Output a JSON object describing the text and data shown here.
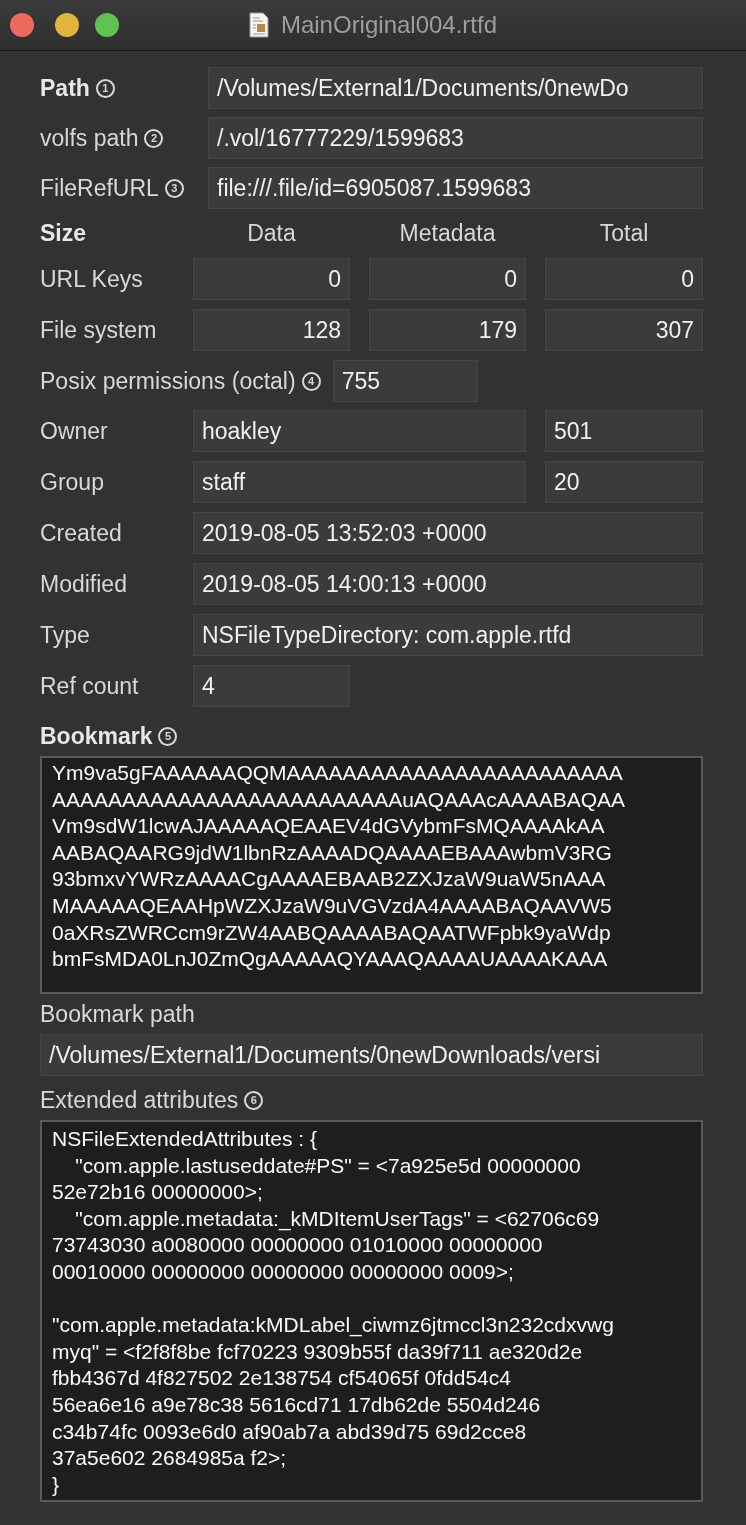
{
  "window": {
    "title": "MainOriginal004.rtfd"
  },
  "identifiers": [
    {
      "label": "Path",
      "bold": true,
      "badge": "1",
      "value": "/Volumes/External1/Documents/0newDo"
    },
    {
      "label": "volfs path",
      "bold": false,
      "badge": "2",
      "value": "/.vol/16777229/1599683"
    },
    {
      "label": "FileRefURL",
      "bold": false,
      "badge": "3",
      "value": "file:///.file/id=6905087.1599683"
    }
  ],
  "size": {
    "label": "Size",
    "columns": [
      "Data",
      "Metadata",
      "Total"
    ],
    "rows": [
      {
        "label": "URL Keys",
        "values": [
          "0",
          "0",
          "0"
        ]
      },
      {
        "label": "File system",
        "values": [
          "128",
          "179",
          "307"
        ]
      }
    ]
  },
  "posix": {
    "label": "Posix permissions (octal)",
    "badge": "4",
    "value": "755"
  },
  "attributes": [
    {
      "kind": "pair",
      "label": "Owner",
      "values": [
        "hoakley",
        "501"
      ]
    },
    {
      "kind": "pair",
      "label": "Group",
      "values": [
        "staff",
        "20"
      ]
    },
    {
      "kind": "wide",
      "label": "Created",
      "values": [
        "2019-08-05 13:52:03 +0000"
      ]
    },
    {
      "kind": "wide",
      "label": "Modified",
      "values": [
        "2019-08-05 14:00:13 +0000"
      ]
    },
    {
      "kind": "wide",
      "label": "Type",
      "values": [
        "NSFileTypeDirectory: com.apple.rtfd"
      ]
    },
    {
      "kind": "short",
      "label": "Ref count",
      "values": [
        "4"
      ]
    }
  ],
  "bookmark": {
    "label": "Bookmark",
    "badge": "5",
    "lines": [
      "Ym9va5gFAAAAAAQQMAAAAAAAAAAAAAAAAAAAAAAAA",
      "AAAAAAAAAAAAAAAAAAAAAAAAAuAQAAAcAAAABAQAA",
      "Vm9sdW1lcwAJAAAAAQEAAEV4dGVybmFsMQAAAAkAA",
      "AABAQAARG9jdW1lbnRzAAAADQAAAAEBAAAwbmV3RG",
      "93bmxvYWRzAAAACgAAAAEBAAB2ZXJzaW9uaW5nAAA",
      "MAAAAAQEAAHpWZXJzaW9uVGVzdA4AAAABAQAAVW5",
      "0aXRsZWRCcm9rZW4AABQAAAABAQAATWFpbk9yaWdp",
      "bmFsMDA0LnJ0ZmQgAAAAAQYAAAQAAAAUAAAAKAAA"
    ]
  },
  "bookmark_path": {
    "label": "Bookmark path",
    "value": "/Volumes/External1/Documents/0newDownloads/versi"
  },
  "extended_attributes": {
    "label": "Extended attributes",
    "badge": "6",
    "blocks": [
      [
        "NSFileExtendedAttributes : {",
        "    \"com.apple.lastuseddate#PS\" = <7a925e5d 00000000",
        "52e72b16 00000000>;",
        "    \"com.apple.metadata:_kMDItemUserTags\" = <62706c69",
        "73743030 a0080000 00000000 01010000 00000000",
        "00010000 00000000 00000000 00000000 0009>;"
      ],
      [
        "\"com.apple.metadata:kMDLabel_ciwmz6jtmccl3n232cdxvwg",
        "myq\" = <f2f8f8be fcf70223 9309b55f da39f711 ae320d2e",
        "fbb4367d 4f827502 2e138754 cf54065f 0fdd54c4",
        "56ea6e16 a9e78c38 5616cd71 17db62de 5504d246",
        "c34b74fc 0093e6d0 af90ab7a abd39d75 69d2cce8",
        "37a5e602 2684985a f2>;",
        "}"
      ]
    ]
  }
}
